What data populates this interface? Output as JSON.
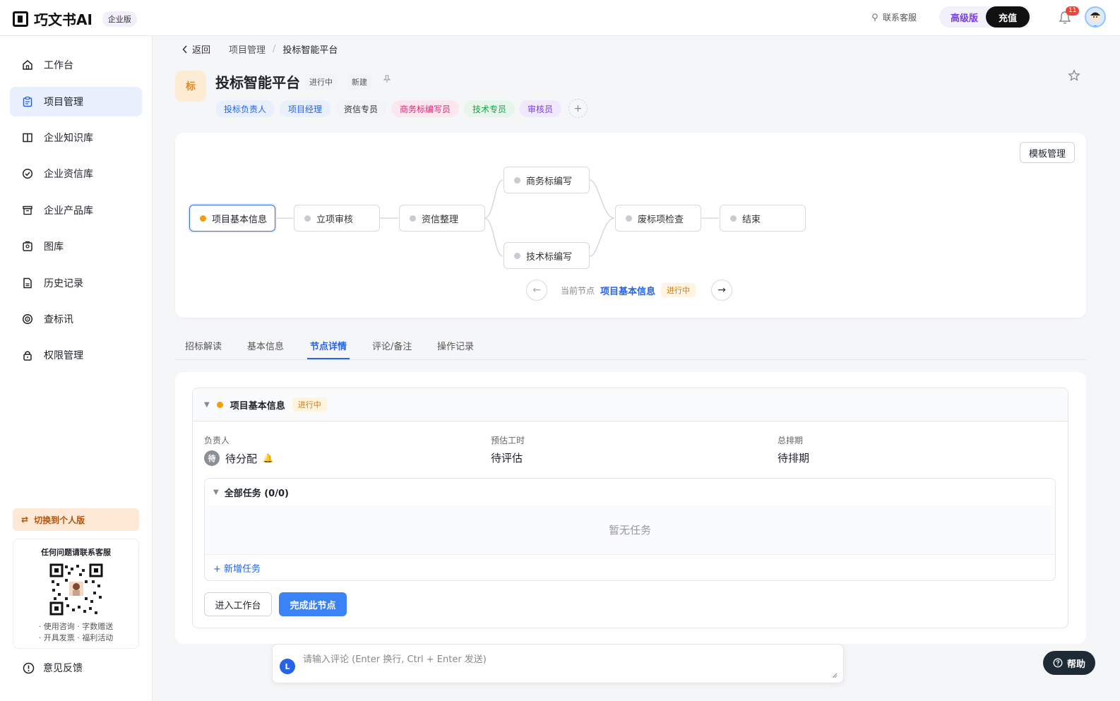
{
  "header": {
    "logo_text": "巧文书AI",
    "edition_badge": "企业版",
    "contact": "联系客服",
    "plan": "高级版",
    "recharge": "充值",
    "notif_count": "11"
  },
  "sidebar": {
    "items": [
      {
        "label": "工作台",
        "icon": "home-icon"
      },
      {
        "label": "项目管理",
        "icon": "clipboard-icon"
      },
      {
        "label": "企业知识库",
        "icon": "book-icon"
      },
      {
        "label": "企业资信库",
        "icon": "check-circle-icon"
      },
      {
        "label": "企业产品库",
        "icon": "box-icon"
      },
      {
        "label": "图库",
        "icon": "image-icon"
      },
      {
        "label": "历史记录",
        "icon": "file-icon"
      },
      {
        "label": "查标讯",
        "icon": "target-icon"
      },
      {
        "label": "权限管理",
        "icon": "lock-icon"
      }
    ],
    "active_index": 1,
    "switch_label": "切换到个人版",
    "qr_title": "任何问题请联系客服",
    "qr_line1": "· 使用咨询 · 字数赠送",
    "qr_line2": "· 开具发票 · 福利活动",
    "feedback": "意见反馈"
  },
  "breadcrumb": {
    "back": "返回",
    "parent": "项目管理",
    "current": "投标智能平台"
  },
  "project": {
    "icon_char": "标",
    "title": "投标智能平台",
    "status": "进行中",
    "type": "新建",
    "roles": [
      {
        "label": "投标负责人",
        "bg": "#e8f0fe",
        "fg": "#2563eb"
      },
      {
        "label": "项目经理",
        "bg": "#e8f0fe",
        "fg": "#2563eb"
      },
      {
        "label": "资信专员",
        "bg": "#f2f3f5",
        "fg": "#333333"
      },
      {
        "label": "商务标编写员",
        "bg": "#fde7ef",
        "fg": "#db2777"
      },
      {
        "label": "技术专员",
        "bg": "#e6f6ea",
        "fg": "#16a34a"
      },
      {
        "label": "审核员",
        "bg": "#f1e8fd",
        "fg": "#7c3aed"
      }
    ],
    "add_role": "+"
  },
  "flow": {
    "template_btn": "模板管理",
    "nodes": [
      {
        "id": "basic",
        "label": "项目基本信息",
        "active": true
      },
      {
        "id": "approve",
        "label": "立项审核"
      },
      {
        "id": "credit",
        "label": "资信整理"
      },
      {
        "id": "biz",
        "label": "商务标编写"
      },
      {
        "id": "tech",
        "label": "技术标编写"
      },
      {
        "id": "check",
        "label": "废标项检查"
      },
      {
        "id": "end",
        "label": "结束"
      }
    ],
    "current_label": "当前节点",
    "current_node": "项目基本信息",
    "current_status": "进行中"
  },
  "tabs": {
    "items": [
      "招标解读",
      "基本信息",
      "节点详情",
      "评论/备注",
      "操作记录"
    ],
    "active_index": 2
  },
  "node_detail": {
    "title": "项目基本信息",
    "status": "进行中",
    "owner_label": "负责人",
    "owner_avatar": "待",
    "owner_value": "待分配",
    "hours_label": "预估工时",
    "hours_value": "待评估",
    "schedule_label": "总排期",
    "schedule_value": "待排期",
    "tasks_title": "全部任务 (0/0)",
    "tasks_empty": "暂无任务",
    "add_task": "+ 新增任务",
    "enter_workspace": "进入工作台",
    "complete_node": "完成此节点"
  },
  "comment": {
    "avatar": "L",
    "placeholder": "请输入评论 (Enter 换行, Ctrl + Enter 发送)"
  },
  "help": "帮助"
}
